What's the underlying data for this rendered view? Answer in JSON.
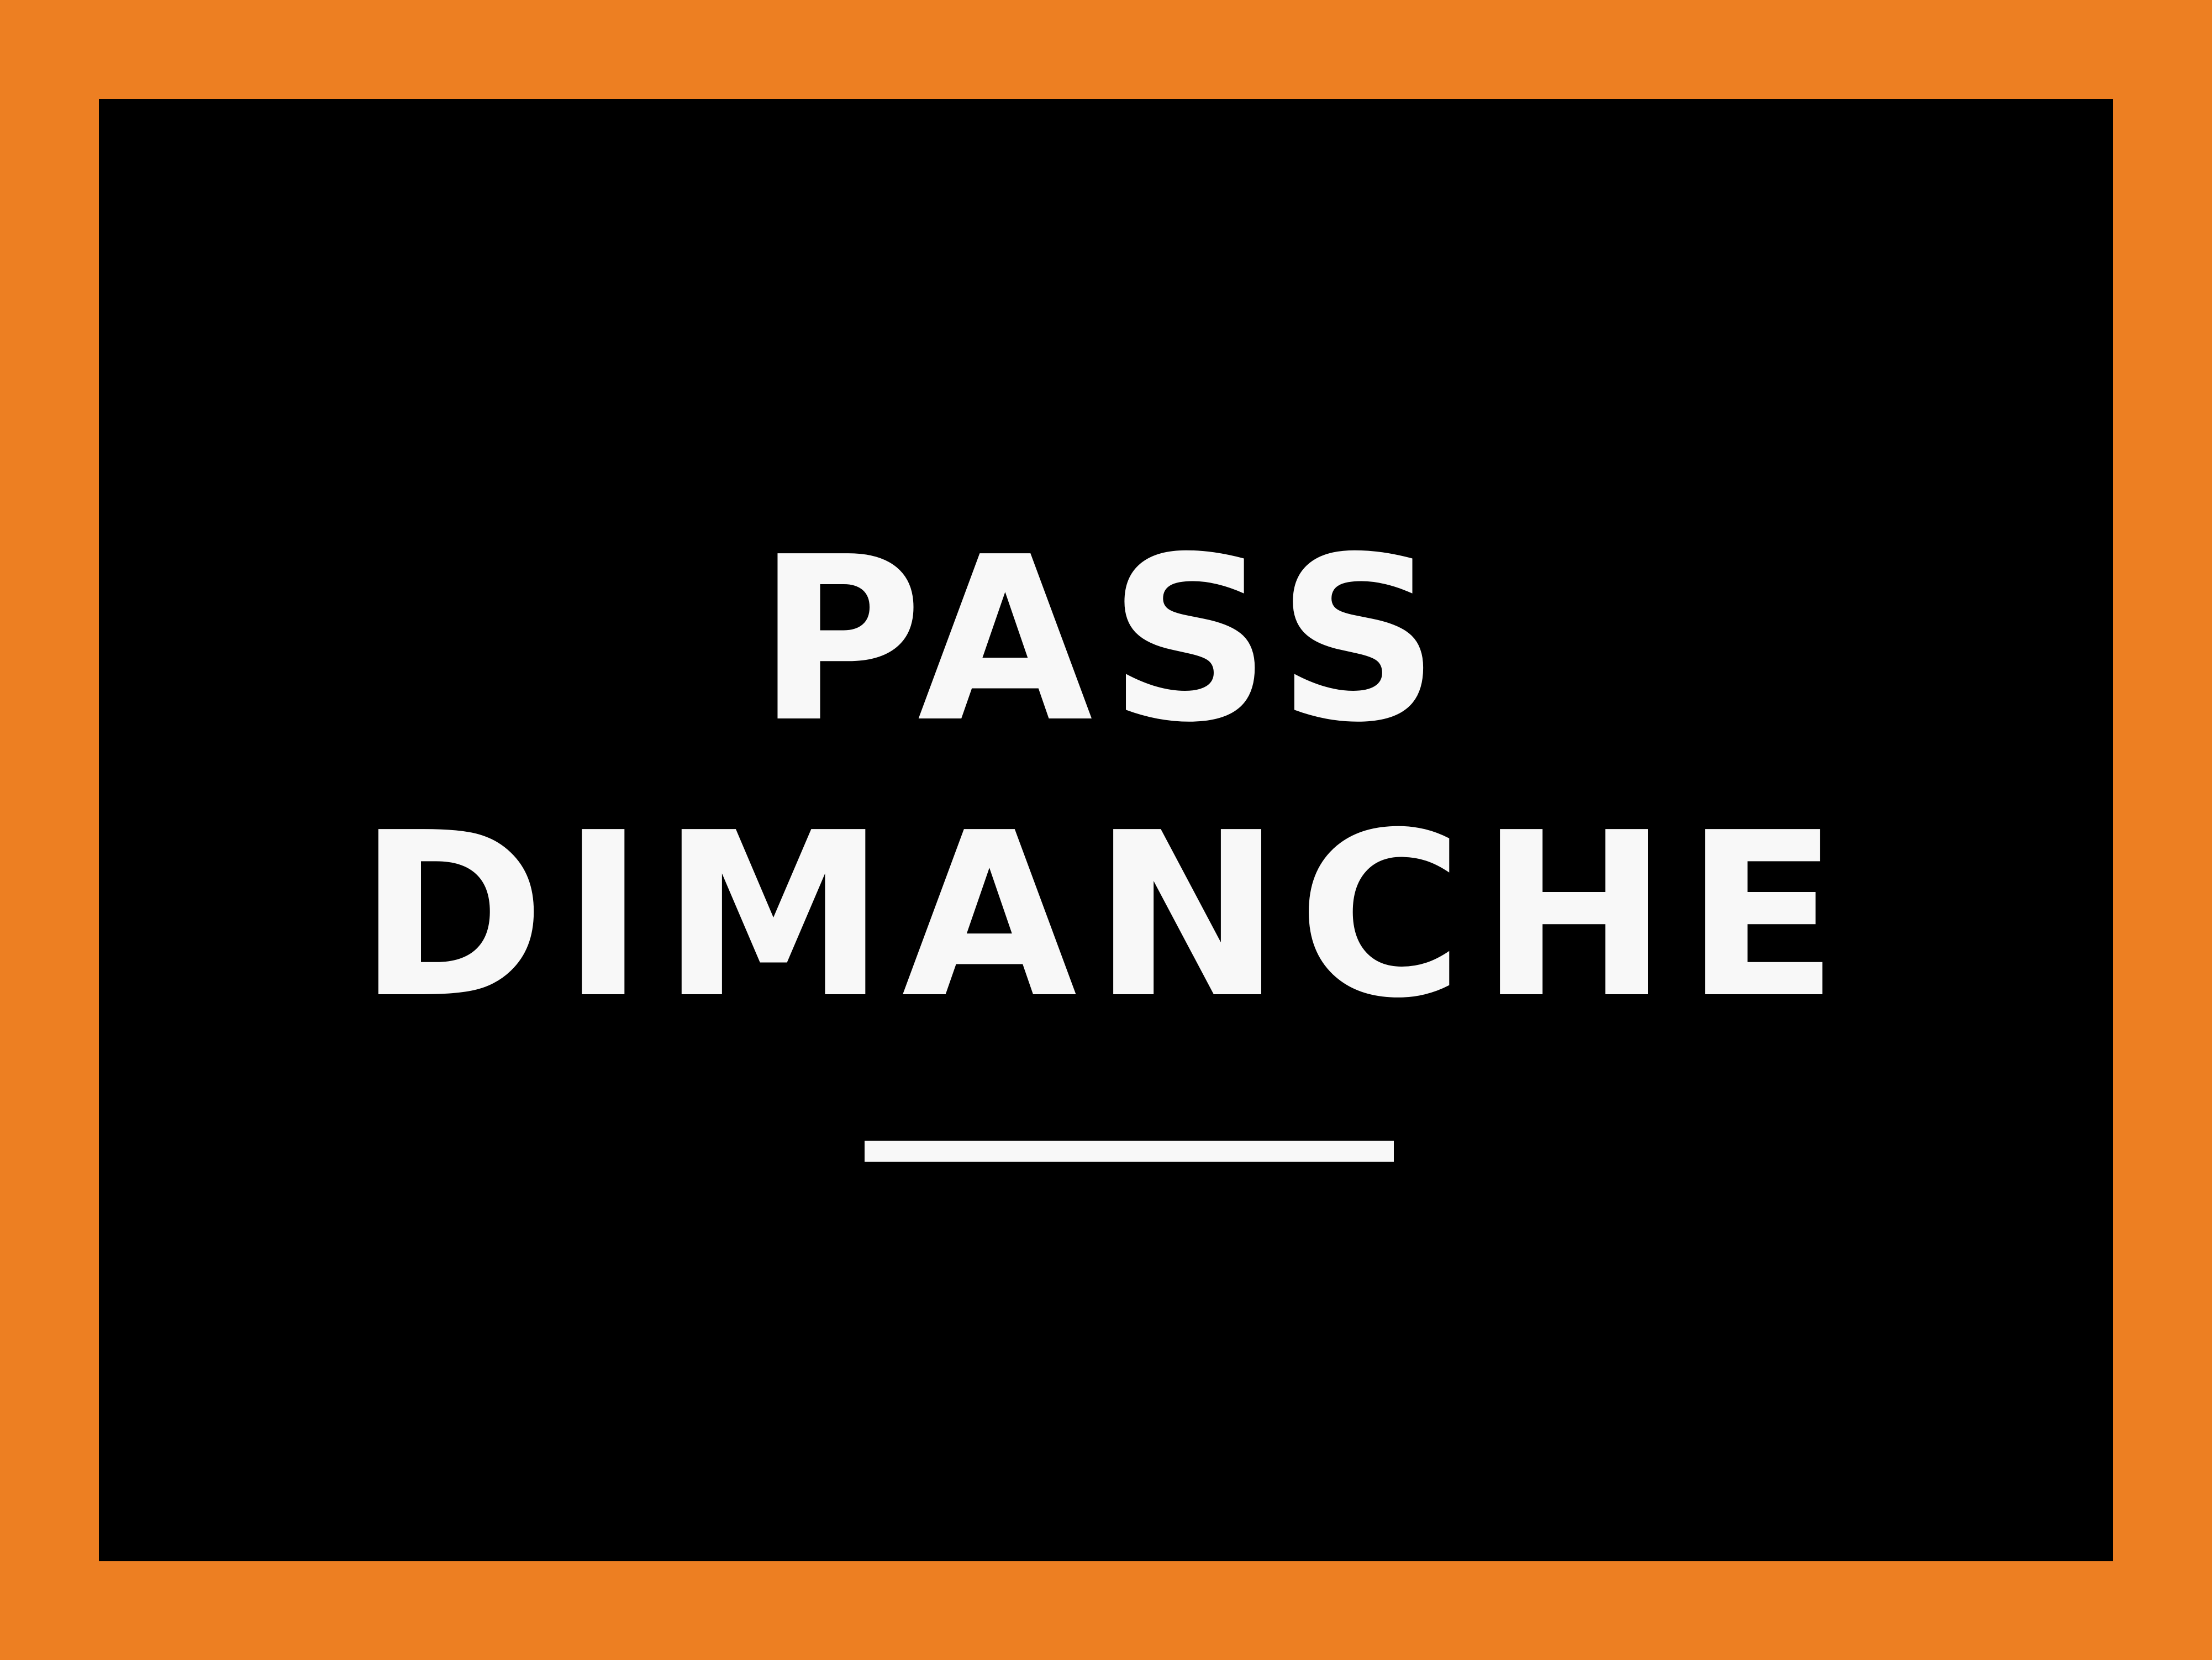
{
  "sign": {
    "line_1": "PASS",
    "line_2": "DIMANCHE"
  },
  "colors": {
    "frame": "#ED7F22",
    "panel": "#000000",
    "text": "#F8F8F8"
  }
}
